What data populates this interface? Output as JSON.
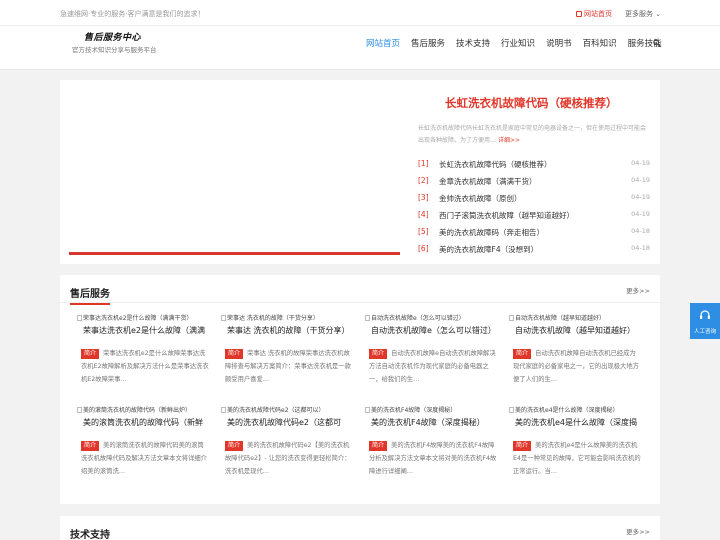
{
  "topbar": {
    "slogan": "急速维网·专业的服务·客户满意是我们的追求！",
    "home_link": "网站首页",
    "more_services": "更多服务 ⌄"
  },
  "header": {
    "logo": "售后服务中心",
    "logo_sub": "官方技术知识分享与服务平台",
    "nav": [
      "网站首页",
      "售后服务",
      "技术支持",
      "行业知识",
      "说明书",
      "百科知识",
      "服务技能"
    ],
    "active_nav": "网站首页"
  },
  "hero": {
    "title": "长虹洗衣机故障代码（硬核推荐）",
    "desc": "长虹洗衣机故障代码长虹洗衣机是家庭中常见的电器设备之一，但在使用过程中可能会出现各种故障。为了方便用…",
    "more": "详细>>",
    "news": [
      {
        "num": "[1]",
        "title": "长虹洗衣机故障代码（硬核推荐）",
        "date": "04-19"
      },
      {
        "num": "[2]",
        "title": "金章洗衣机故障（满满干货）",
        "date": "04-19"
      },
      {
        "num": "[3]",
        "title": "金帅洗衣机故障（原创）",
        "date": "04-19"
      },
      {
        "num": "[4]",
        "title": "西门子滚筒洗衣机故障（越早知道越好）",
        "date": "04-19"
      },
      {
        "num": "[5]",
        "title": "美的洗衣机故障码（奔走相告）",
        "date": "04-18"
      },
      {
        "num": "[6]",
        "title": "美的洗衣机故障F4（没想到）",
        "date": "04-18"
      }
    ]
  },
  "section1": {
    "title": "售后服务",
    "more": "更多>>",
    "tag": "简介",
    "cards": [
      {
        "img_alt": "荣事达洗衣机e2是什么故障（满满干货）",
        "title": "荣事达洗衣机e2是什么故障（满满",
        "brief": "荣事达洗衣机e2是什么故障荣事达洗衣机E2故障解析及解决方法什么是荣事达洗衣机E2故障荣事…"
      },
      {
        "img_alt": "荣事达 洗衣机的故障（干货分享）",
        "title": "荣事达 洗衣机的故障（干货分享）",
        "brief": "荣事达 洗衣机的故障荣事达洗衣机故障排查与解决方案简介：荣事达洗衣机是一款颇受用户喜爱…"
      },
      {
        "img_alt": "自动洗衣机故障e（怎么可以错过）",
        "title": "自动洗衣机故障e（怎么可以错过）",
        "brief": "自动洗衣机故障e自动洗衣机故障解决方法自动洗衣机作为现代家庭的必备电器之一，给我们的生…"
      },
      {
        "img_alt": "自动洗衣机故障（越早知道越好）",
        "title": "自动洗衣机故障（越早知道越好）",
        "brief": "自动洗衣机故障自动洗衣机已经成为现代家庭的必备家电之一，它的出现极大地方便了人们的生…"
      },
      {
        "img_alt": "美的滚筒洗衣机的故障代码（新鲜出炉）",
        "title": "美的滚筒洗衣机的故障代码（新鲜",
        "brief": "美的滚筒洗衣机的故障代码美的滚筒洗衣机故障代码及解决方法文章本文将详细介绍美的滚筒洗…"
      },
      {
        "img_alt": "美的洗衣机故障代码e2（这都可以）",
        "title": "美的洗衣机故障代码e2（这都可",
        "brief": "美的洗衣机故障代码e2【美的洗衣机故障代码e2】- 让您的洗衣变得更轻松简介：洗衣机是现代…"
      },
      {
        "img_alt": "美的洗衣机F4故障（深度揭秘）",
        "title": "美的洗衣机F4故障（深度揭秘）",
        "brief": "美的洗衣机F4故障美的洗衣机F4故障分析及解决方法文章本文将对美的洗衣机F4故障进行详细阐…"
      },
      {
        "img_alt": "美的洗衣机e4是什么故障（深度揭秘）",
        "title": "美的洗衣机e4是什么故障（深度揭",
        "brief": "美的洗衣机e4是什么故障美的洗衣机E4是一种常见的故障，它可能会影响洗衣机的正常运行。当…"
      }
    ]
  },
  "section2": {
    "title": "技术支持",
    "more": "更多>>"
  },
  "float_button": {
    "label": "人工咨询"
  },
  "colors": {
    "accent_red": "#e0372a",
    "nav_blue": "#2d8ee4"
  }
}
